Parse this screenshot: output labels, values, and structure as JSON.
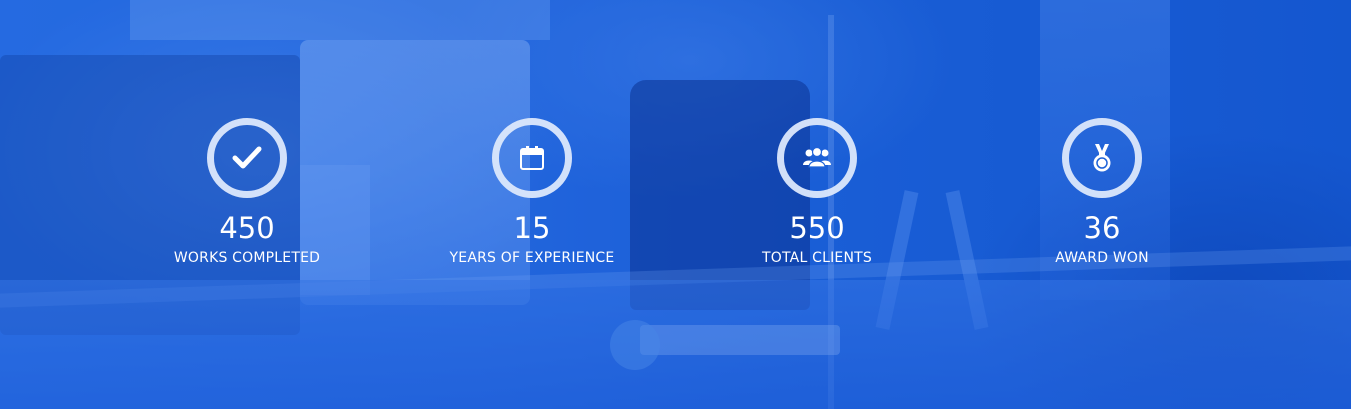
{
  "stats": [
    {
      "value": "450",
      "label": "WORKS COMPLETED",
      "icon": "check-icon"
    },
    {
      "value": "15",
      "label": "YEARS OF EXPERIENCE",
      "icon": "calendar-icon"
    },
    {
      "value": "550",
      "label": "TOTAL CLIENTS",
      "icon": "users-icon"
    },
    {
      "value": "36",
      "label": "AWARD WON",
      "icon": "medal-icon"
    }
  ],
  "colors": {
    "overlay": "#1f63d8",
    "ring": "#dce8fc",
    "text": "#ffffff"
  }
}
